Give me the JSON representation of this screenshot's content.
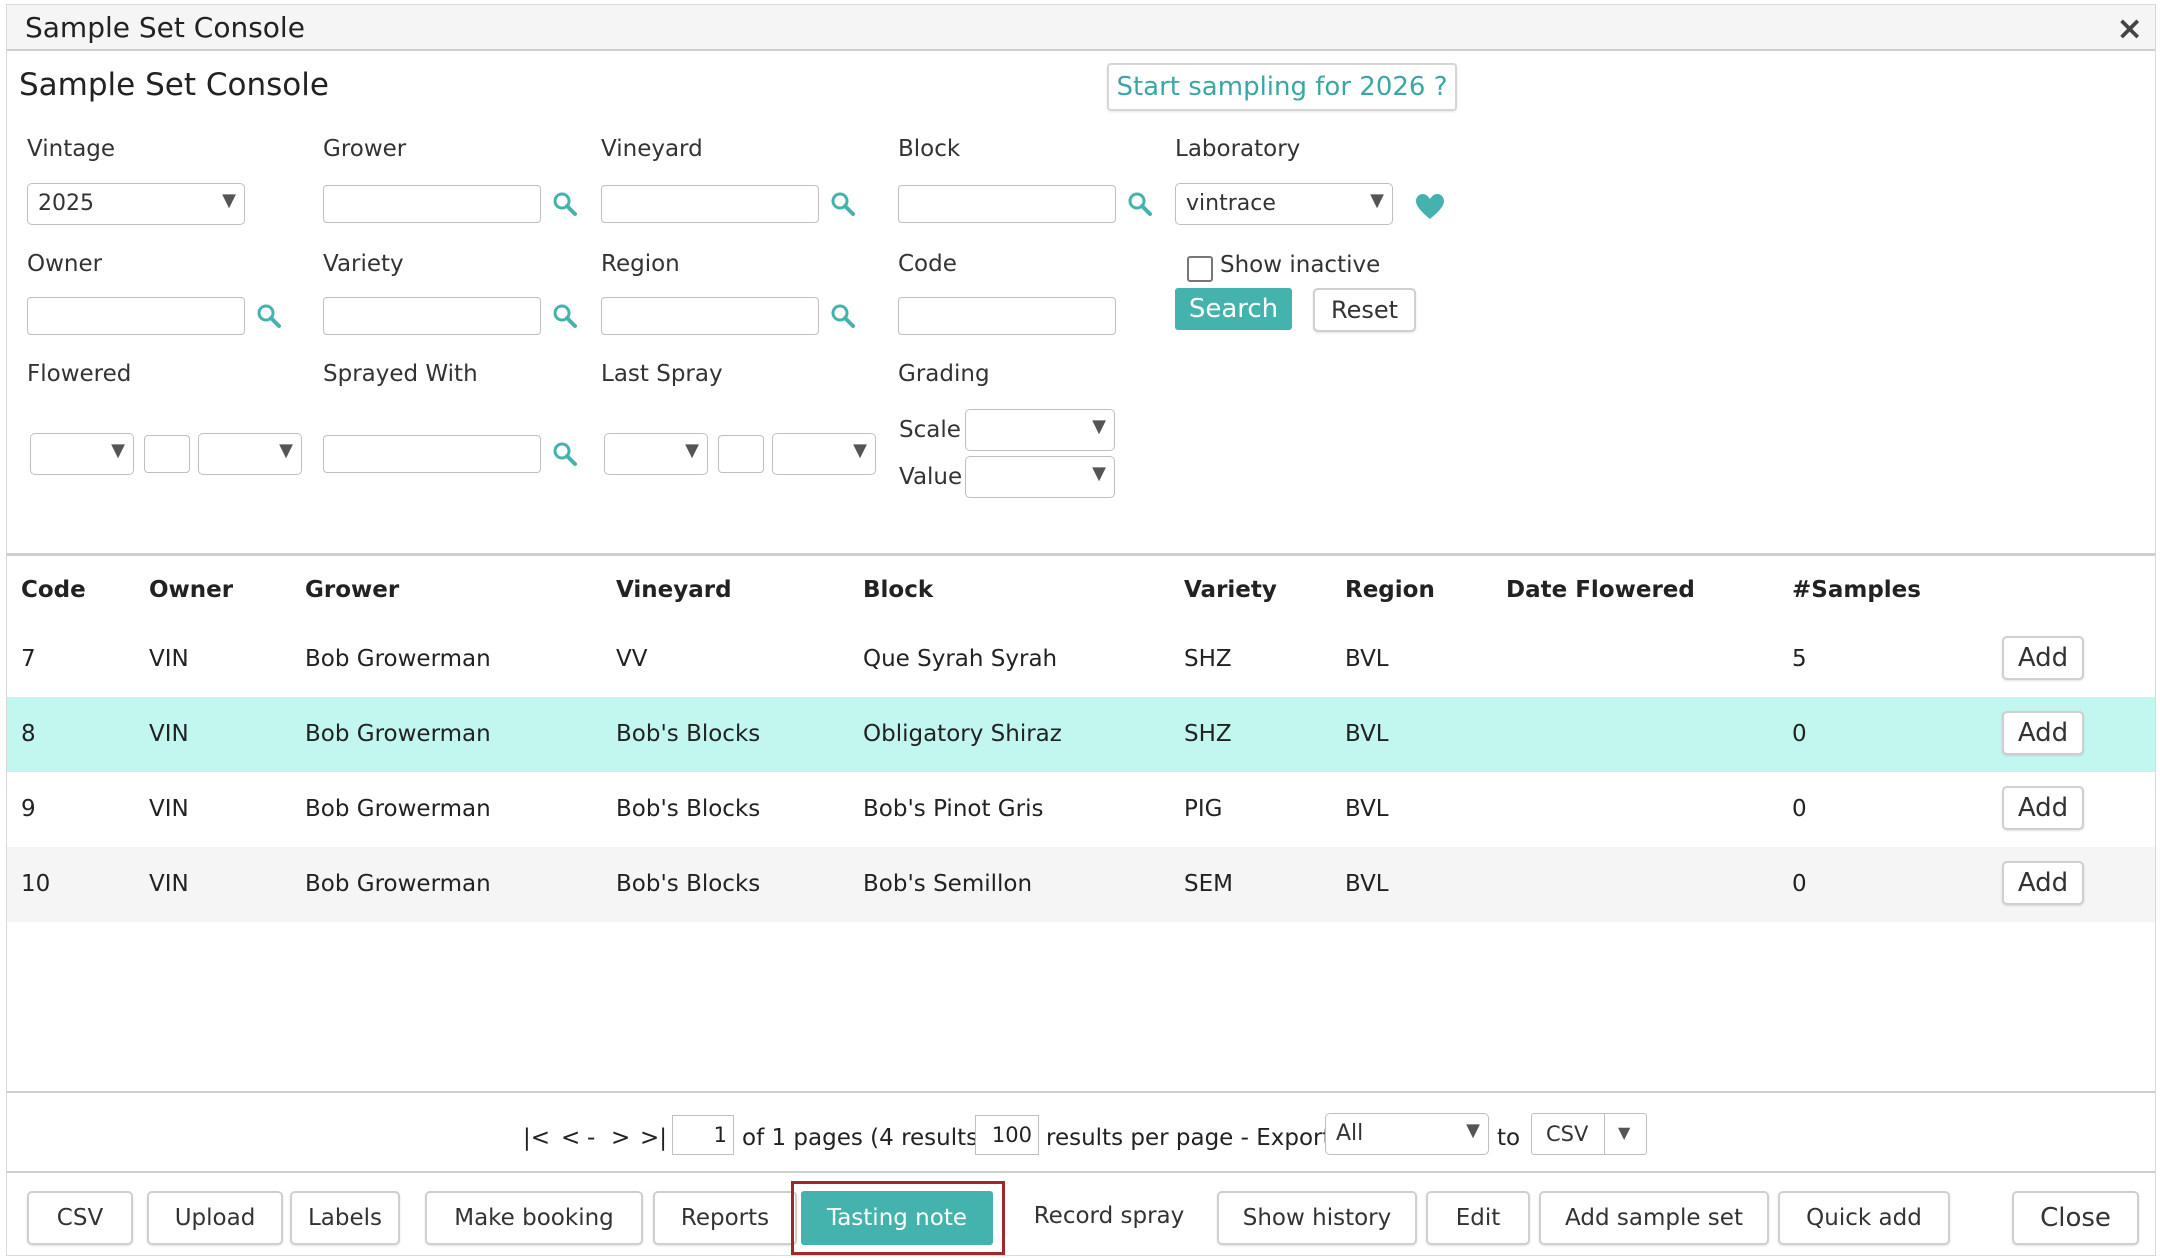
{
  "window": {
    "title": "Sample Set Console",
    "close_glyph": "×"
  },
  "page_heading": "Sample Set Console",
  "start_sampling": "Start sampling for 2026 ?",
  "filters": {
    "vintage": {
      "label": "Vintage",
      "value": "2025"
    },
    "grower": {
      "label": "Grower",
      "value": ""
    },
    "vineyard": {
      "label": "Vineyard",
      "value": ""
    },
    "block": {
      "label": "Block",
      "value": ""
    },
    "laboratory": {
      "label": "Laboratory",
      "value": "vintrace"
    },
    "owner": {
      "label": "Owner",
      "value": ""
    },
    "variety": {
      "label": "Variety",
      "value": ""
    },
    "region": {
      "label": "Region",
      "value": ""
    },
    "code": {
      "label": "Code",
      "value": ""
    },
    "show_inactive": {
      "label": "Show inactive",
      "checked": false
    },
    "flowered": {
      "label": "Flowered"
    },
    "sprayed_with": {
      "label": "Sprayed With"
    },
    "last_spray": {
      "label": "Last Spray"
    },
    "grading": {
      "label": "Grading",
      "scale_label": "Scale",
      "value_label": "Value"
    }
  },
  "buttons": {
    "search": "Search",
    "reset": "Reset"
  },
  "table": {
    "headers": [
      "Code",
      "Owner",
      "Grower",
      "Vineyard",
      "Block",
      "Variety",
      "Region",
      "Date Flowered",
      "#Samples"
    ],
    "add_label": "Add",
    "rows": [
      {
        "code": "7",
        "owner": "VIN",
        "grower": "Bob Growerman",
        "vineyard": "VV",
        "block": "Que Syrah Syrah",
        "variety": "SHZ",
        "region": "BVL",
        "date_flowered": "",
        "samples": "5"
      },
      {
        "code": "8",
        "owner": "VIN",
        "grower": "Bob Growerman",
        "vineyard": "Bob's Blocks",
        "block": "Obligatory Shiraz",
        "variety": "SHZ",
        "region": "BVL",
        "date_flowered": "",
        "samples": "0",
        "selected": true
      },
      {
        "code": "9",
        "owner": "VIN",
        "grower": "Bob Growerman",
        "vineyard": "Bob's Blocks",
        "block": "Bob's Pinot Gris",
        "variety": "PIG",
        "region": "BVL",
        "date_flowered": "",
        "samples": "0"
      },
      {
        "code": "10",
        "owner": "VIN",
        "grower": "Bob Growerman",
        "vineyard": "Bob's Blocks",
        "block": "Bob's Semillon",
        "variety": "SEM",
        "region": "BVL",
        "date_flowered": "",
        "samples": "0"
      }
    ]
  },
  "pagination": {
    "first": "|<",
    "prev": "<",
    "dash": "-",
    "next": ">",
    "last": ">|",
    "page": "1",
    "pages_text": "of 1 pages (4 results).",
    "per_page": "100",
    "per_page_text": "results per page - Export",
    "export_scope": "All",
    "to_text": "to",
    "format": "CSV"
  },
  "bottom_buttons": {
    "csv": "CSV",
    "upload": "Upload",
    "labels": "Labels",
    "make_booking": "Make booking",
    "reports": "Reports",
    "tasting_note": "Tasting note",
    "record_spray": "Record spray",
    "show_history": "Show history",
    "edit": "Edit",
    "add_sample_set": "Add sample set",
    "quick_add": "Quick add",
    "close": "Close"
  },
  "colors": {
    "accent": "#44b3ad",
    "selected_row": "#c2f7f0",
    "alt_row": "#f5f5f5",
    "highlight_border": "#9b2b2b"
  }
}
